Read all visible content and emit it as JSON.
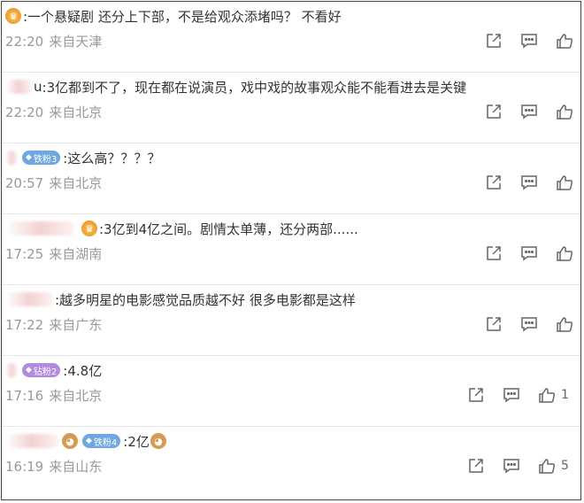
{
  "icons": {
    "share": "share-icon",
    "comment": "comment-icon",
    "like": "like-icon"
  },
  "colors": {
    "meta": "#999999",
    "iron_badge": "#6fa7e0",
    "drill_badge": "#b28be0",
    "crown": "#ee9a2b"
  },
  "comments": [
    {
      "prefix": "",
      "text": ":一个悬疑剧 还分上下部，不是给观众添堵吗？ 不看好",
      "time": "22:20",
      "location": "来自天津",
      "likes": ""
    },
    {
      "prefix": "u",
      "text": ":3亿都到不了，现在都在说演员，戏中戏的故事观众能不能看进去是关键",
      "time": "22:20",
      "location": "来自北京",
      "likes": ""
    },
    {
      "badge": "铁粉3",
      "text": ":这么高？？？？",
      "time": "20:57",
      "location": "来自北京",
      "likes": ""
    },
    {
      "text": ":3亿到4亿之间。剧情太单薄，还分两部......",
      "time": "17:25",
      "location": "来自湖南",
      "likes": ""
    },
    {
      "text": ":越多明星的电影感觉品质越不好 很多电影都是这样",
      "time": "17:22",
      "location": "来自广东",
      "likes": ""
    },
    {
      "badge": "钻粉2",
      "text": ":4.8亿",
      "time": "17:16",
      "location": "来自北京",
      "likes": "1"
    },
    {
      "badge": "铁粉4",
      "text": ":2亿",
      "time": "16:19",
      "location": "来自山东",
      "likes": "5"
    }
  ]
}
